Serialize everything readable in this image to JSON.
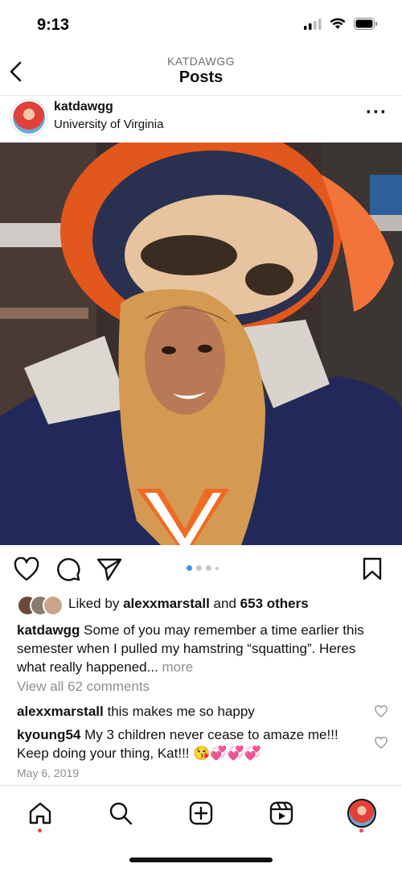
{
  "status_bar": {
    "time": "9:13"
  },
  "nav": {
    "subtitle": "KATDAWGG",
    "title": "Posts"
  },
  "post": {
    "username": "katdawgg",
    "location": "University of Virginia",
    "carousel": {
      "count": 4,
      "active_index": 0
    },
    "likes": {
      "prefix": "Liked by ",
      "user": "alexxmarstall",
      "middle": " and ",
      "count": "653 others"
    },
    "caption": {
      "username": "katdawgg",
      "text": " Some of you may remember a time earlier this semester when I pulled my hamstring “squatting”. Heres what really happened... ",
      "more": "more"
    },
    "view_all_comments": "View all 62 comments",
    "comments": [
      {
        "user": "alexxmarstall",
        "text": " this makes me so happy"
      },
      {
        "user": "kyoung54",
        "text": " My 3 children never cease to amaze me!!! Keep doing your thing, Kat!!! 😘💞💞💞"
      }
    ],
    "date": "May 6, 2019"
  },
  "tabbar": {
    "items": [
      "home-icon",
      "search-icon",
      "create-icon",
      "reels-icon",
      "profile-avatar"
    ]
  },
  "colors": {
    "accent": "#3897f0",
    "notification": "#ed4956",
    "uva_orange": "#e57200",
    "uva_navy": "#232d4b"
  }
}
